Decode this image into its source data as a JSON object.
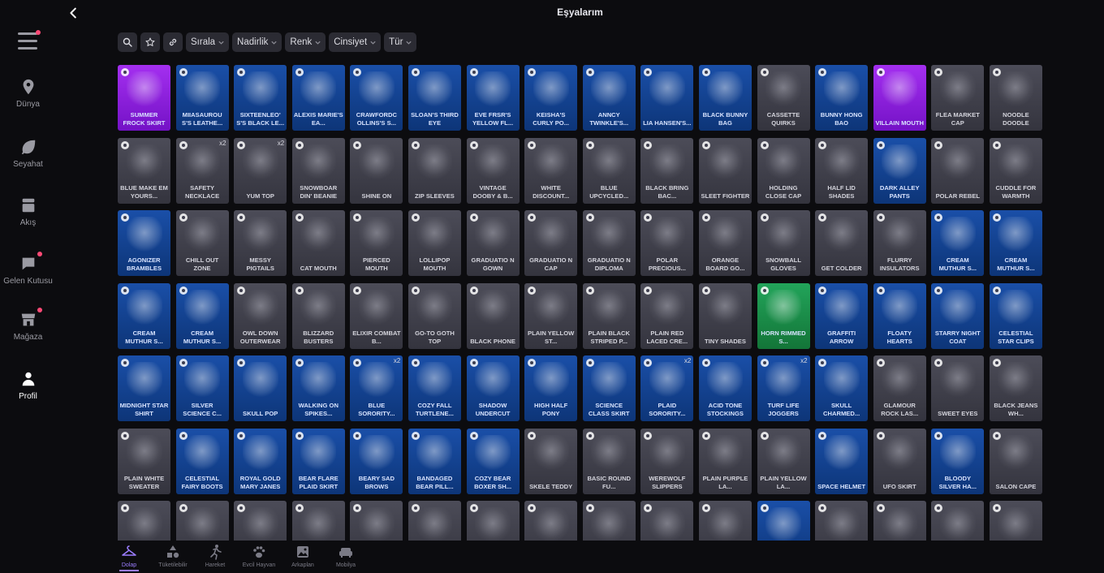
{
  "header": {
    "title": "Eşyalarım"
  },
  "sidebar": {
    "items": [
      {
        "label": "Dünya",
        "icon": "location-pin-icon",
        "badge": false
      },
      {
        "label": "Seyahat",
        "icon": "leaf-icon",
        "badge": false
      },
      {
        "label": "Akış",
        "icon": "feed-icon",
        "badge": false
      },
      {
        "label": "Gelen Kutusu",
        "icon": "chat-bubble-icon",
        "badge": true
      },
      {
        "label": "Mağaza",
        "icon": "store-icon",
        "badge": true
      },
      {
        "label": "Profil",
        "icon": "person-icon",
        "badge": false,
        "active": true
      }
    ]
  },
  "filters": {
    "sort": "Sırala",
    "rarity": "Nadirlik",
    "color": "Renk",
    "gender": "Cinsiyet",
    "type": "Tür"
  },
  "tabs": [
    {
      "label": "Dolap",
      "icon": "hanger-icon",
      "active": true
    },
    {
      "label": "Tüketilebilir",
      "icon": "shapes-icon"
    },
    {
      "label": "Hareket",
      "icon": "running-figure-icon"
    },
    {
      "label": "Evcil Hayvan",
      "icon": "paw-icon"
    },
    {
      "label": "Arkaplan",
      "icon": "image-icon"
    },
    {
      "label": "Mobilya",
      "icon": "sofa-icon"
    }
  ],
  "colors": {
    "accent": "#9b7dff",
    "blue_card": "#1a4fa8",
    "gray_card": "#4c4c58",
    "purple_card": "#a42ff0",
    "green_card": "#22a45a",
    "badge": "#ff4a76"
  },
  "items": [
    {
      "name": "SUMMER FROCK SKIRT",
      "tone": "purple"
    },
    {
      "name": "MIIASAUROU S'S LEATHE...",
      "tone": "blue"
    },
    {
      "name": "SIXTEENLEO' S'S BLACK LE...",
      "tone": "blue"
    },
    {
      "name": "ALEXIS MARIE'S EA...",
      "tone": "blue"
    },
    {
      "name": "CRAWFORDC OLLINS'S S...",
      "tone": "blue"
    },
    {
      "name": "SLOAN'S THIRD EYE",
      "tone": "blue"
    },
    {
      "name": "EVE FRSR'S YELLOW FL...",
      "tone": "blue"
    },
    {
      "name": "KEISHA'S CURLY PO...",
      "tone": "blue"
    },
    {
      "name": "ANNCY TWINKLE'S...",
      "tone": "blue"
    },
    {
      "name": "LIA HANSEN'S...",
      "tone": "blue"
    },
    {
      "name": "BLACK BUNNY BAG",
      "tone": "blue"
    },
    {
      "name": "CASSETTE QUIRKS",
      "tone": "gray"
    },
    {
      "name": "BUNNY HONG BAO",
      "tone": "blue"
    },
    {
      "name": "VILLAIN MOUTH",
      "tone": "purple"
    },
    {
      "name": "FLEA MARKET CAP",
      "tone": "gray"
    },
    {
      "name": "NOODLE DOODLE",
      "tone": "gray"
    },
    {
      "name": "BLUE MAKE EM YOURS...",
      "tone": "gray"
    },
    {
      "name": "SAFETY NECKLACE",
      "tone": "gray",
      "qty": "x2"
    },
    {
      "name": "YUM TOP",
      "tone": "gray",
      "qty": "x2"
    },
    {
      "name": "SNOWBOAR DIN' BEANIE",
      "tone": "gray"
    },
    {
      "name": "SHINE ON",
      "tone": "gray"
    },
    {
      "name": "ZIP SLEEVES",
      "tone": "gray"
    },
    {
      "name": "VINTAGE DOOBY & B...",
      "tone": "gray"
    },
    {
      "name": "WHITE DISCOUNT...",
      "tone": "gray"
    },
    {
      "name": "BLUE UPCYCLED...",
      "tone": "gray"
    },
    {
      "name": "BLACK BRING BAC...",
      "tone": "gray"
    },
    {
      "name": "SLEET FIGHTER",
      "tone": "gray"
    },
    {
      "name": "HOLDING CLOSE CAP",
      "tone": "gray"
    },
    {
      "name": "HALF LID SHADES",
      "tone": "gray"
    },
    {
      "name": "DARK ALLEY PANTS",
      "tone": "blue"
    },
    {
      "name": "POLAR REBEL",
      "tone": "gray"
    },
    {
      "name": "CUDDLE FOR WARMTH",
      "tone": "gray"
    },
    {
      "name": "AGONIZER BRAMBLES",
      "tone": "blue"
    },
    {
      "name": "CHILL OUT ZONE",
      "tone": "gray"
    },
    {
      "name": "MESSY PIGTAILS",
      "tone": "gray"
    },
    {
      "name": "CAT MOUTH",
      "tone": "gray"
    },
    {
      "name": "PIERCED MOUTH",
      "tone": "gray"
    },
    {
      "name": "LOLLIPOP MOUTH",
      "tone": "gray"
    },
    {
      "name": "GRADUATIO N GOWN",
      "tone": "gray"
    },
    {
      "name": "GRADUATIO N CAP",
      "tone": "gray"
    },
    {
      "name": "GRADUATIO N DIPLOMA",
      "tone": "gray"
    },
    {
      "name": "POLAR PRECIOUS...",
      "tone": "gray"
    },
    {
      "name": "ORANGE BOARD GO...",
      "tone": "gray"
    },
    {
      "name": "SNOWBALL GLOVES",
      "tone": "gray"
    },
    {
      "name": "GET COLDER",
      "tone": "gray"
    },
    {
      "name": "FLURRY INSULATORS",
      "tone": "gray"
    },
    {
      "name": "CREAM MUTHUR S...",
      "tone": "blue"
    },
    {
      "name": "CREAM MUTHUR S...",
      "tone": "blue"
    },
    {
      "name": "CREAM MUTHUR S...",
      "tone": "blue"
    },
    {
      "name": "CREAM MUTHUR S...",
      "tone": "blue"
    },
    {
      "name": "OWL DOWN OUTERWEAR",
      "tone": "gray"
    },
    {
      "name": "BLIZZARD BUSTERS",
      "tone": "gray"
    },
    {
      "name": "ELIXIR COMBAT B...",
      "tone": "gray"
    },
    {
      "name": "GO-TO GOTH TOP",
      "tone": "gray"
    },
    {
      "name": "BLACK PHONE",
      "tone": "gray"
    },
    {
      "name": "PLAIN YELLOW ST...",
      "tone": "gray"
    },
    {
      "name": "PLAIN BLACK STRIPED P...",
      "tone": "gray"
    },
    {
      "name": "PLAIN RED LACED CRE...",
      "tone": "gray"
    },
    {
      "name": "TINY SHADES",
      "tone": "gray"
    },
    {
      "name": "HORN RIMMED S...",
      "tone": "green"
    },
    {
      "name": "GRAFFITI ARROW",
      "tone": "blue"
    },
    {
      "name": "FLOATY HEARTS",
      "tone": "blue"
    },
    {
      "name": "STARRY NIGHT COAT",
      "tone": "blue"
    },
    {
      "name": "CELESTIAL STAR CLIPS",
      "tone": "blue"
    },
    {
      "name": "MIDNIGHT STAR SHIRT",
      "tone": "blue"
    },
    {
      "name": "SILVER SCIENCE C...",
      "tone": "blue"
    },
    {
      "name": "SKULL POP",
      "tone": "blue"
    },
    {
      "name": "WALKING ON SPIKES...",
      "tone": "blue"
    },
    {
      "name": "BLUE SORORITY...",
      "tone": "blue",
      "qty": "x2"
    },
    {
      "name": "COZY FALL TURTLENE...",
      "tone": "blue"
    },
    {
      "name": "SHADOW UNDERCUT",
      "tone": "blue"
    },
    {
      "name": "HIGH HALF PONY",
      "tone": "blue"
    },
    {
      "name": "SCIENCE CLASS SKIRT",
      "tone": "blue"
    },
    {
      "name": "PLAID SORORITY...",
      "tone": "blue",
      "qty": "x2"
    },
    {
      "name": "ACID TONE STOCKINGS",
      "tone": "blue"
    },
    {
      "name": "TURF LIFE JOGGERS",
      "tone": "blue",
      "qty": "x2"
    },
    {
      "name": "SKULL CHARMED...",
      "tone": "blue"
    },
    {
      "name": "GLAMOUR ROCK LAS...",
      "tone": "gray"
    },
    {
      "name": "SWEET EYES",
      "tone": "gray"
    },
    {
      "name": "BLACK JEANS WH...",
      "tone": "gray"
    },
    {
      "name": "PLAIN WHITE SWEATER",
      "tone": "gray"
    },
    {
      "name": "CELESTIAL FAIRY BOOTS",
      "tone": "blue"
    },
    {
      "name": "ROYAL GOLD MARY JANES",
      "tone": "blue"
    },
    {
      "name": "BEAR FLARE PLAID SKIRT",
      "tone": "blue"
    },
    {
      "name": "BEARY SAD BROWS",
      "tone": "blue"
    },
    {
      "name": "BANDAGED BEAR PILL...",
      "tone": "blue"
    },
    {
      "name": "COZY BEAR BOXER SH...",
      "tone": "blue"
    },
    {
      "name": "SKELE TEDDY",
      "tone": "gray"
    },
    {
      "name": "BASIC ROUND FU...",
      "tone": "gray"
    },
    {
      "name": "WEREWOLF SLIPPERS",
      "tone": "gray"
    },
    {
      "name": "PLAIN PURPLE LA...",
      "tone": "gray"
    },
    {
      "name": "PLAIN YELLOW LA...",
      "tone": "gray"
    },
    {
      "name": "SPACE HELMET",
      "tone": "blue"
    },
    {
      "name": "UFO SKIRT",
      "tone": "gray"
    },
    {
      "name": "BLOODY SILVER HA...",
      "tone": "blue"
    },
    {
      "name": "SALON CAPE",
      "tone": "gray"
    },
    {
      "name": "",
      "tone": "gray"
    },
    {
      "name": "",
      "tone": "gray"
    },
    {
      "name": "",
      "tone": "gray"
    },
    {
      "name": "",
      "tone": "gray"
    },
    {
      "name": "",
      "tone": "gray"
    },
    {
      "name": "",
      "tone": "gray"
    },
    {
      "name": "",
      "tone": "gray"
    },
    {
      "name": "",
      "tone": "gray"
    },
    {
      "name": "",
      "tone": "gray"
    },
    {
      "name": "",
      "tone": "gray"
    },
    {
      "name": "",
      "tone": "gray"
    },
    {
      "name": "",
      "tone": "blue"
    },
    {
      "name": "",
      "tone": "gray"
    },
    {
      "name": "",
      "tone": "gray"
    },
    {
      "name": "",
      "tone": "gray"
    },
    {
      "name": "",
      "tone": "gray"
    }
  ]
}
